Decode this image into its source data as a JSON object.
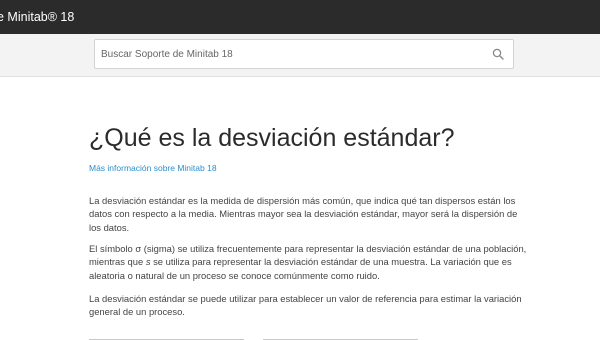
{
  "header": {
    "brand": "e Minitab® 18"
  },
  "search": {
    "placeholder": "Buscar Soporte de Minitab 18",
    "icon": "search-icon"
  },
  "article": {
    "title": "¿Qué es la desviación estándar?",
    "more_link": "Más información sobre Minitab 18",
    "paragraph1": "La desviación estándar es la medida de dispersión más común, que indica qué tan dispersos están los datos con respecto a la media. Mientras mayor sea la desviación estándar, mayor será la dispersión de los datos.",
    "paragraph2": {
      "part1": "El símbolo σ (sigma) se utiliza frecuentemente para representar la desviación estándar de una población, mientras que ",
      "symbol": "s",
      "part2": " se utiliza para representar la desviación estándar de una muestra. La variación que es aleatoria o natural de un proceso se conoce comúnmente como ruido."
    },
    "paragraph3": "La desviación estándar se puede utilizar para establecer un valor de referencia para estimar la variación general de un proceso."
  },
  "colors": {
    "topbar": "#2b2b2b",
    "link": "#2a8fcf",
    "search_band": "#f3f3f3"
  }
}
